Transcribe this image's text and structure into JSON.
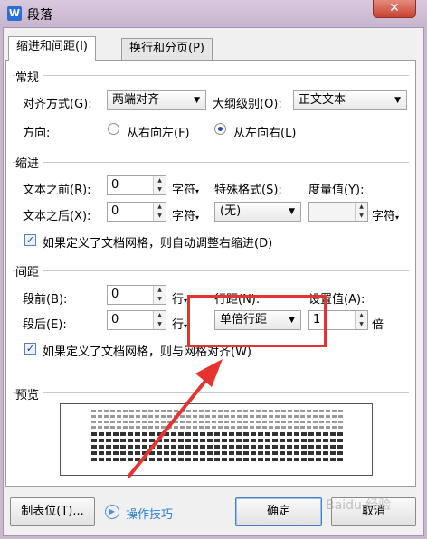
{
  "window": {
    "title": "段落",
    "close_label": "✕",
    "app_icon_letter": "W"
  },
  "tabs": [
    {
      "label": "缩进和间距(I)"
    },
    {
      "label": "换行和分页(P)"
    }
  ],
  "general": {
    "section": "常规",
    "align_label": "对齐方式(G):",
    "align_value": "两端对齐",
    "outline_label": "大纲级别(O):",
    "outline_value": "正文文本",
    "direction_label": "方向:",
    "rtl_label": "从右向左(F)",
    "ltr_label": "从左向右(L)",
    "direction_selected": "ltr"
  },
  "indent": {
    "section": "缩进",
    "before_label": "文本之前(R):",
    "before_value": "0",
    "before_unit": "字符",
    "after_label": "文本之后(X):",
    "after_value": "0",
    "after_unit": "字符",
    "special_label": "特殊格式(S):",
    "special_value": "(无)",
    "measure_label": "度量值(Y):",
    "measure_value": "",
    "measure_unit": "字符",
    "grid_check_label": "如果定义了文档网格，则自动调整右缩进(D)",
    "grid_checked": true
  },
  "spacing": {
    "section": "间距",
    "before_label": "段前(B):",
    "before_value": "0",
    "before_unit": "行",
    "after_label": "段后(E):",
    "after_value": "0",
    "after_unit": "行",
    "line_label": "行距(N):",
    "line_value": "单倍行距",
    "set_label": "设置值(A):",
    "set_value": "1",
    "set_unit": "倍",
    "grid_check_label": "如果定义了文档网格，则与网格对齐(W)",
    "grid_checked": true
  },
  "preview": {
    "section": "预览"
  },
  "footer": {
    "tabs_button": "制表位(T)...",
    "tips_link": "操作技巧",
    "ok_button": "确定",
    "cancel_button": "取消"
  },
  "annotation": {
    "color": "#e53330"
  },
  "watermark": "Baidu 经验"
}
